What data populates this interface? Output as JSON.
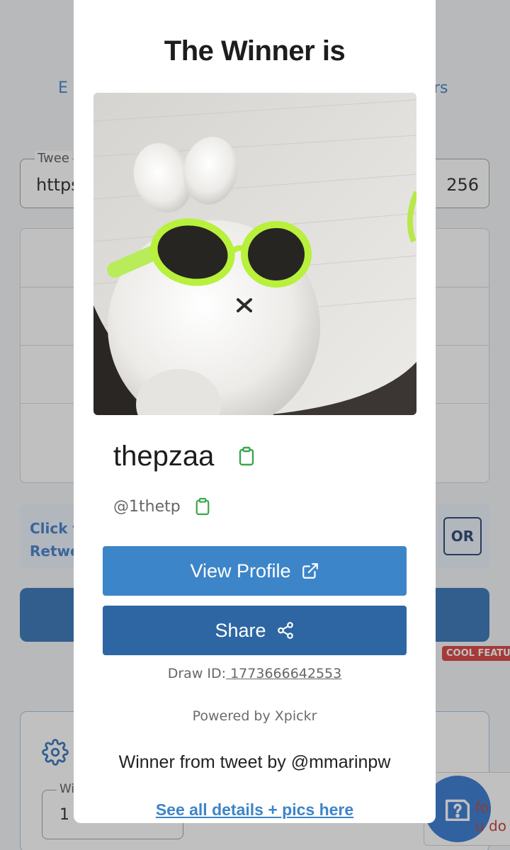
{
  "background": {
    "tab_left": "E",
    "tab_right": "rs",
    "tweet_field": {
      "label": "Twee",
      "value_left": "https",
      "value_right": "256"
    },
    "info_text": "Click t\nRetwe",
    "or_label": "OR",
    "cool_badge": "COOL FEATU",
    "settings_field": {
      "label": "Wi",
      "value": "1"
    },
    "help_text": "fo\nu do"
  },
  "modal": {
    "title": "The Winner is",
    "winner_name": "thepzaa",
    "winner_handle": "@1thetp",
    "view_profile_label": "View Profile",
    "share_label": "Share",
    "draw_id_label": "Draw ID:",
    "draw_id_value": " 1773666642553",
    "powered_by": "Powered by Xpickr",
    "tweet_by": "Winner from tweet by @mmarinpw",
    "details_link": "See all details + pics here"
  },
  "icons": {
    "copy": "clipboard-icon",
    "external": "external-link-icon",
    "share": "share-icon",
    "settings": "gear-icon",
    "help": "help-icon"
  },
  "colors": {
    "primary_button": "#3d85c9",
    "share_button": "#2d66a2",
    "copy_icon": "#3aa64c",
    "link": "#3d85c9",
    "badge": "#d93838"
  }
}
